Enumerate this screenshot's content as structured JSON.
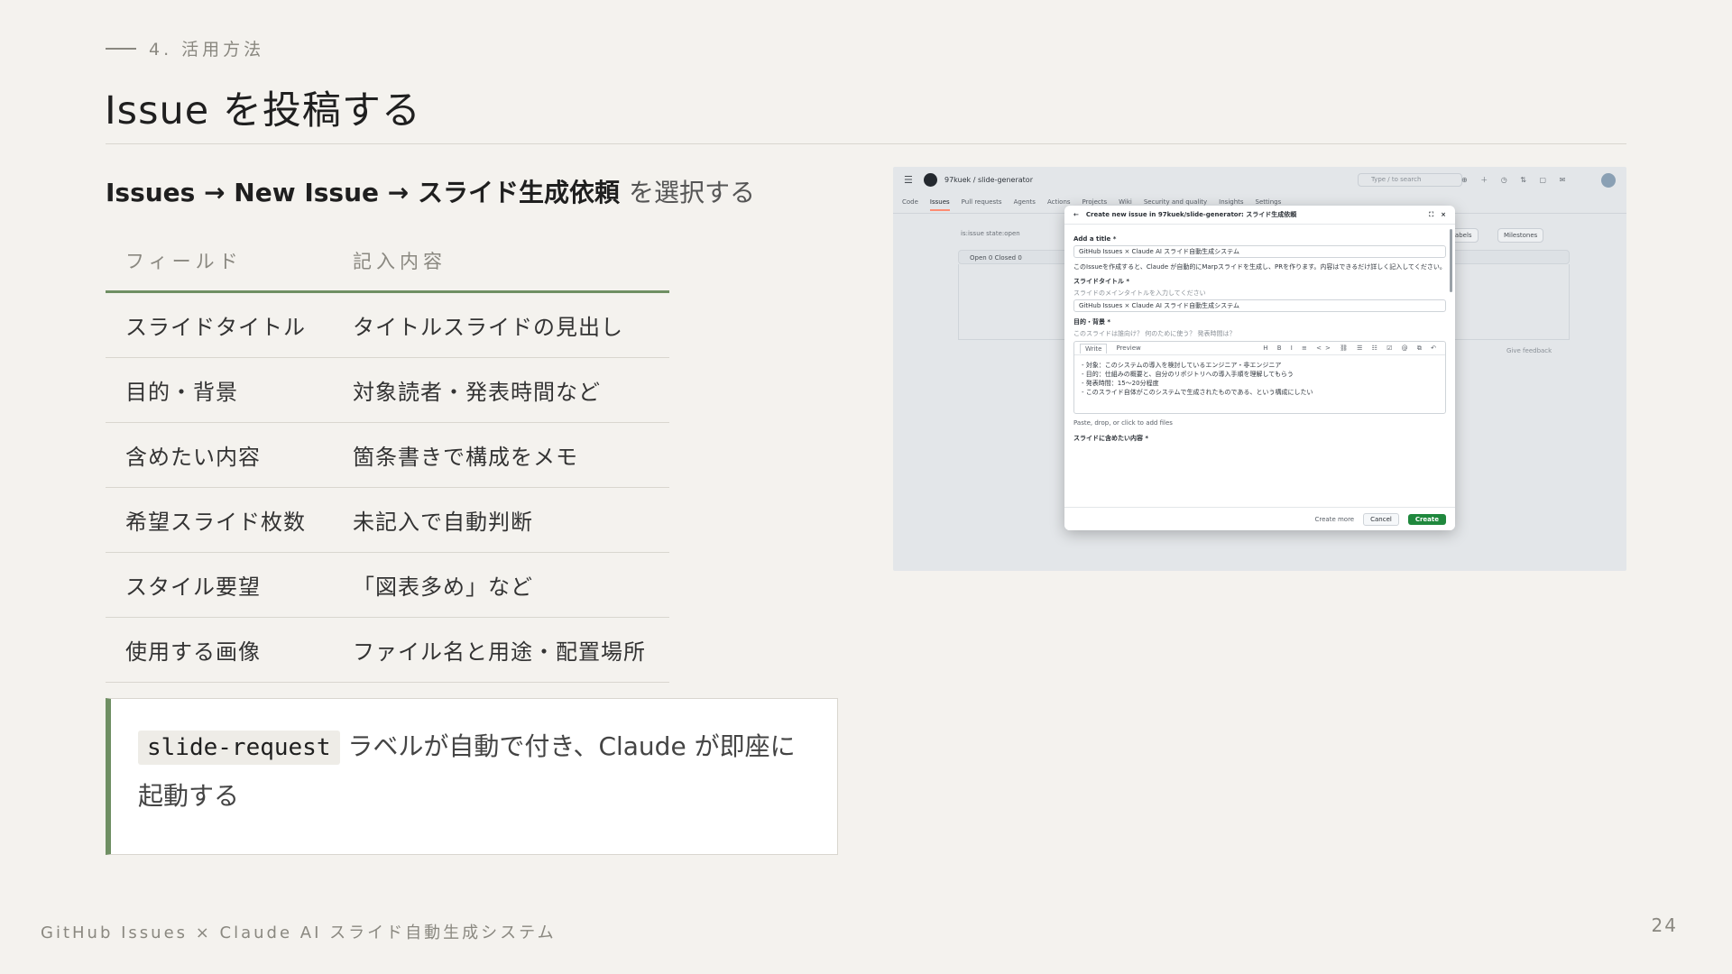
{
  "section": {
    "label": "4. 活用方法"
  },
  "title": "Issue を投稿する",
  "lead": {
    "strong": "Issues → New Issue → スライド生成依頼",
    "rest": "を選択する"
  },
  "table": {
    "headers": [
      "フィールド",
      "記入内容"
    ],
    "rows": [
      [
        "スライドタイトル",
        "タイトルスライドの見出し"
      ],
      [
        "目的・背景",
        "対象読者・発表時間など"
      ],
      [
        "含めたい内容",
        "箇条書きで構成をメモ"
      ],
      [
        "希望スライド枚数",
        "未記入で自動判断"
      ],
      [
        "スタイル要望",
        "「図表多め」など"
      ],
      [
        "使用する画像",
        "ファイル名と用途・配置場所"
      ]
    ]
  },
  "callout": {
    "code": "slide-request",
    "text": "ラベルが自動で付き、Claude が即座に起動する"
  },
  "footer": {
    "text": "GitHub Issues × Claude AI スライド自動生成システム",
    "page": "24"
  },
  "screenshot": {
    "repo": "97kuek / slide-generator",
    "search_placeholder": "Type / to search",
    "tabs": [
      "Code",
      "Issues",
      "Pull requests",
      "Agents",
      "Actions",
      "Projects",
      "Wiki",
      "Security and quality",
      "Insights",
      "Settings"
    ],
    "filter": "is:issue state:open",
    "labels_btn": "Labels",
    "milestones_btn": "Milestones",
    "list_head": "Open 0   Closed 0",
    "feedback": "Give feedback",
    "modal": {
      "header": "Create new issue in 97kuek/slide-generator: スライド生成依頼",
      "add_title_label": "Add a title *",
      "title_value": "GitHub Issues × Claude AI スライド自動生成システム",
      "note": "このIssueを作成すると、Claude が自動的にMarpスライドを生成し、PRを作ります。内容はできるだけ詳しく記入してください。",
      "slide_title_label": "スライドタイトル *",
      "slide_title_hint": "スライドのメインタイトルを入力してください",
      "slide_title_value": "GitHub Issues × Claude AI スライド自動生成システム",
      "purpose_label": "目的・背景 *",
      "purpose_hint": "このスライドは誰向け？ 何のために使う？ 発表時間は？",
      "editor_tabs": [
        "Write",
        "Preview"
      ],
      "editor_lines": [
        "- 対象：このシステムの導入を検討しているエンジニア・非エンジニア",
        "- 目的：仕組みの概要と、自分のリポジトリへの導入手順を理解してもらう",
        "- 発表時間：15〜20分程度",
        "- このスライド自体がこのシステムで生成されたものである、という構成にしたい"
      ],
      "attach": "Paste, drop, or click to add files",
      "more_label": "スライドに含めたい内容 *",
      "create_more": "Create more",
      "cancel": "Cancel",
      "create": "Create"
    }
  }
}
